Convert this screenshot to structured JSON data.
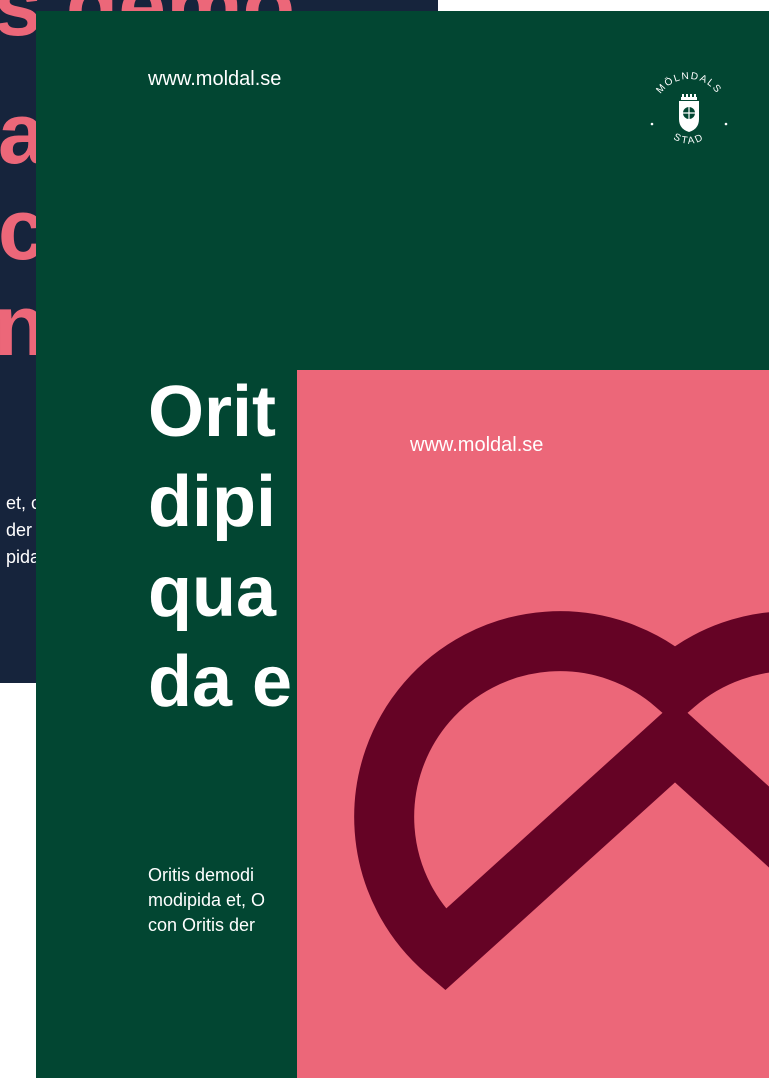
{
  "colors": {
    "navy": "#16243c",
    "green": "#024632",
    "pink": "#ec6779",
    "burgundy": "#650325",
    "white": "#ffffff"
  },
  "poster_navy": {
    "headline_lines": [
      "s demo",
      "a",
      "c",
      "n"
    ],
    "body_lines": [
      "et, c",
      "der",
      "pida"
    ]
  },
  "poster_green": {
    "url": "www.moldal.se",
    "logo": {
      "top_text": "MÖLNDALS",
      "bottom_text": "STAD",
      "icon": "molndal-crest-icon"
    },
    "headline_lines": [
      "Orit",
      "dipi",
      "qua",
      "da e"
    ],
    "body_lines": [
      "Oritis demodi",
      "modipida et, O",
      "con Oritis der"
    ]
  },
  "poster_pink": {
    "url": "www.moldal.se",
    "icon": "heart-icon"
  }
}
